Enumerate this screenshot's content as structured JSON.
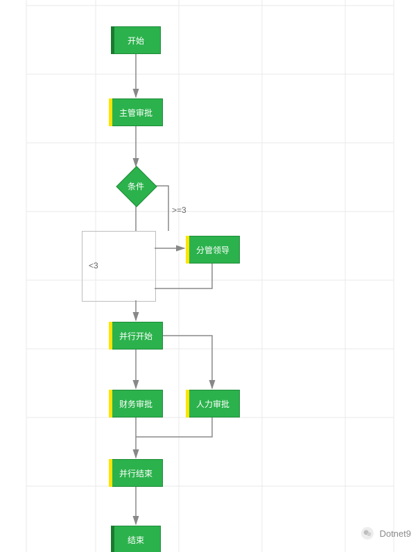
{
  "chart_data": {
    "type": "flowchart",
    "title": "",
    "nodes": [
      {
        "id": "start",
        "kind": "start",
        "label": "开始"
      },
      {
        "id": "supervisor",
        "kind": "task",
        "label": "主管审批"
      },
      {
        "id": "cond",
        "kind": "decision",
        "label": "条件"
      },
      {
        "id": "leader",
        "kind": "task",
        "label": "分管领导"
      },
      {
        "id": "par_begin",
        "kind": "task",
        "label": "并行开始"
      },
      {
        "id": "finance",
        "kind": "task",
        "label": "财务审批"
      },
      {
        "id": "hr",
        "kind": "task",
        "label": "人力审批"
      },
      {
        "id": "par_end",
        "kind": "task",
        "label": "并行结束"
      },
      {
        "id": "end",
        "kind": "end",
        "label": "结束"
      }
    ],
    "edges": [
      {
        "from": "start",
        "to": "supervisor",
        "label": ""
      },
      {
        "from": "supervisor",
        "to": "cond",
        "label": ""
      },
      {
        "from": "cond",
        "to": "leader",
        "label": ">=3"
      },
      {
        "from": "cond",
        "to": "par_begin",
        "label": "<3"
      },
      {
        "from": "leader",
        "to": "par_begin",
        "label": ""
      },
      {
        "from": "par_begin",
        "to": "finance",
        "label": ""
      },
      {
        "from": "par_begin",
        "to": "hr",
        "label": ""
      },
      {
        "from": "finance",
        "to": "par_end",
        "label": ""
      },
      {
        "from": "hr",
        "to": "par_end",
        "label": ""
      },
      {
        "from": "par_end",
        "to": "end",
        "label": ""
      }
    ]
  },
  "nodes": {
    "start": "开始",
    "supervisor": "主管审批",
    "cond": "条件",
    "leader": "分管领导",
    "par_begin": "并行开始",
    "finance": "财务审批",
    "hr": "人力审批",
    "par_end": "并行结束",
    "end": "结束"
  },
  "labels": {
    "ge3": ">=3",
    "lt3": "<3"
  },
  "watermark": {
    "name": "Dotnet9"
  }
}
